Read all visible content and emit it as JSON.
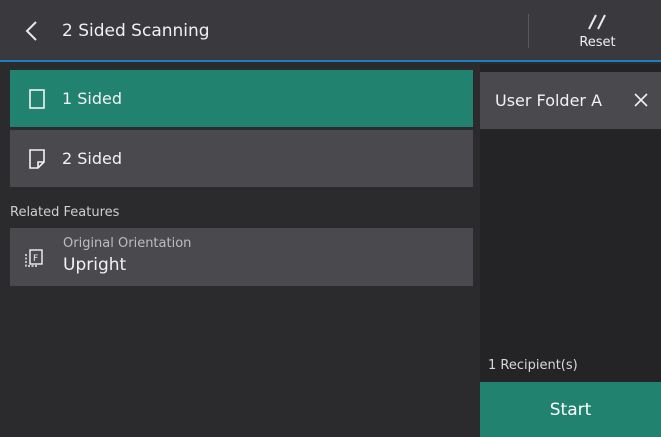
{
  "header": {
    "title": "2 Sided Scanning",
    "reset_label": "Reset",
    "back_icon": "chevron-left-icon",
    "reset_icon": "double-slash-icon"
  },
  "options": [
    {
      "label": "1 Sided",
      "icon": "page-icon",
      "selected": true
    },
    {
      "label": "2 Sided",
      "icon": "page-folded-icon",
      "selected": false
    }
  ],
  "related": {
    "heading": "Related Features",
    "items": [
      {
        "title": "Original Orientation",
        "value": "Upright",
        "icon": "orientation-icon"
      }
    ]
  },
  "recipients": {
    "items": [
      {
        "name": "User Folder A"
      }
    ],
    "count_text": "1 Recipient(s)"
  },
  "start_label": "Start",
  "colors": {
    "accent": "#21826f",
    "header_border": "#1e7fbf",
    "tile": "#4a4a4e",
    "background": "#2b2b2d"
  }
}
